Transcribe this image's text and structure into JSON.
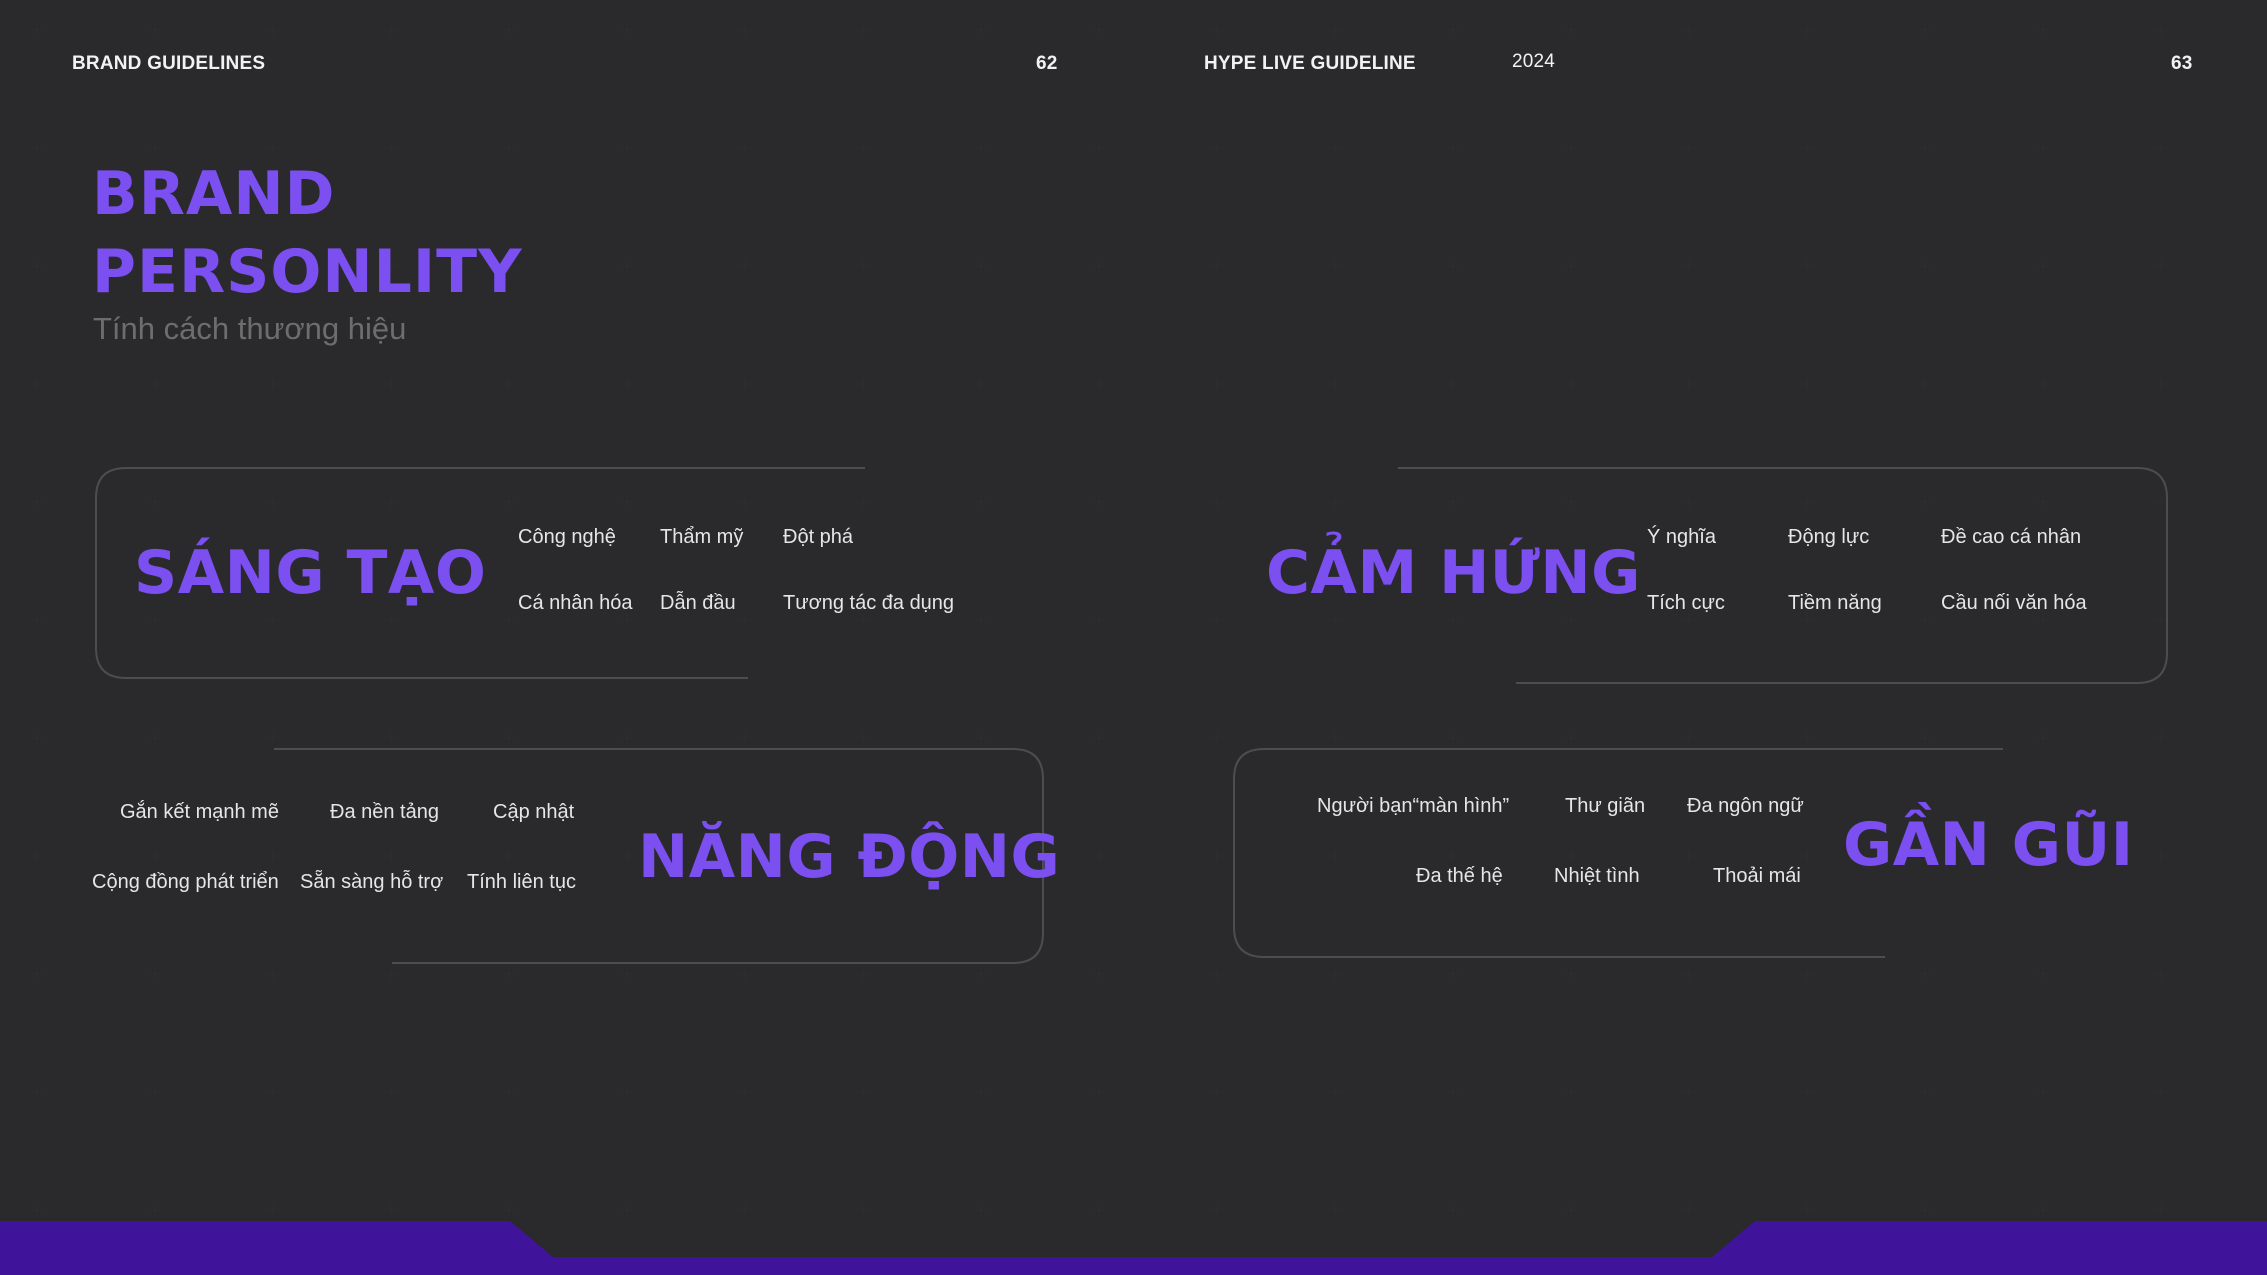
{
  "header": {
    "left_title": "BRAND GUIDELINES",
    "left_page": "62",
    "right_title": "HYPE LIVE GUIDELINE",
    "year": "2024",
    "right_page": "63"
  },
  "title": {
    "line1": "BRAND",
    "line2": "PERSONLITY",
    "subtitle": "Tính cách thương hiệu"
  },
  "traits": [
    {
      "name": "SÁNG TẠO",
      "keywords": [
        "Công nghệ",
        "Thẩm mỹ",
        "Đột phá",
        "Cá nhân hóa",
        "Dẫn đầu",
        "Tương tác đa dụng"
      ]
    },
    {
      "name": "CẢM HỨNG",
      "keywords": [
        "Ý nghĩa",
        "Động lực",
        "Đề cao cá nhân",
        "Tích cực",
        "Tiềm năng",
        "Cầu nối văn hóa"
      ]
    },
    {
      "name": "NĂNG ĐỘNG",
      "keywords": [
        "Gắn kết mạnh mẽ",
        "Đa nền tảng",
        "Cập nhật",
        "Cộng đồng phát triển",
        "Sẵn sàng hỗ trợ",
        "Tính liên tục"
      ]
    },
    {
      "name": "GẦN GŨI",
      "keywords": [
        "Người bạn“màn hình”",
        "Thư giãn",
        "Đa ngôn ngữ",
        "Đa thế hệ",
        "Nhiệt tình",
        "Thoải mái"
      ]
    }
  ],
  "colors": {
    "background": "#1a1a1b",
    "accent": "#7b4ff0",
    "footer_bar": "#3f139a",
    "card_border": "#4d4d50"
  }
}
